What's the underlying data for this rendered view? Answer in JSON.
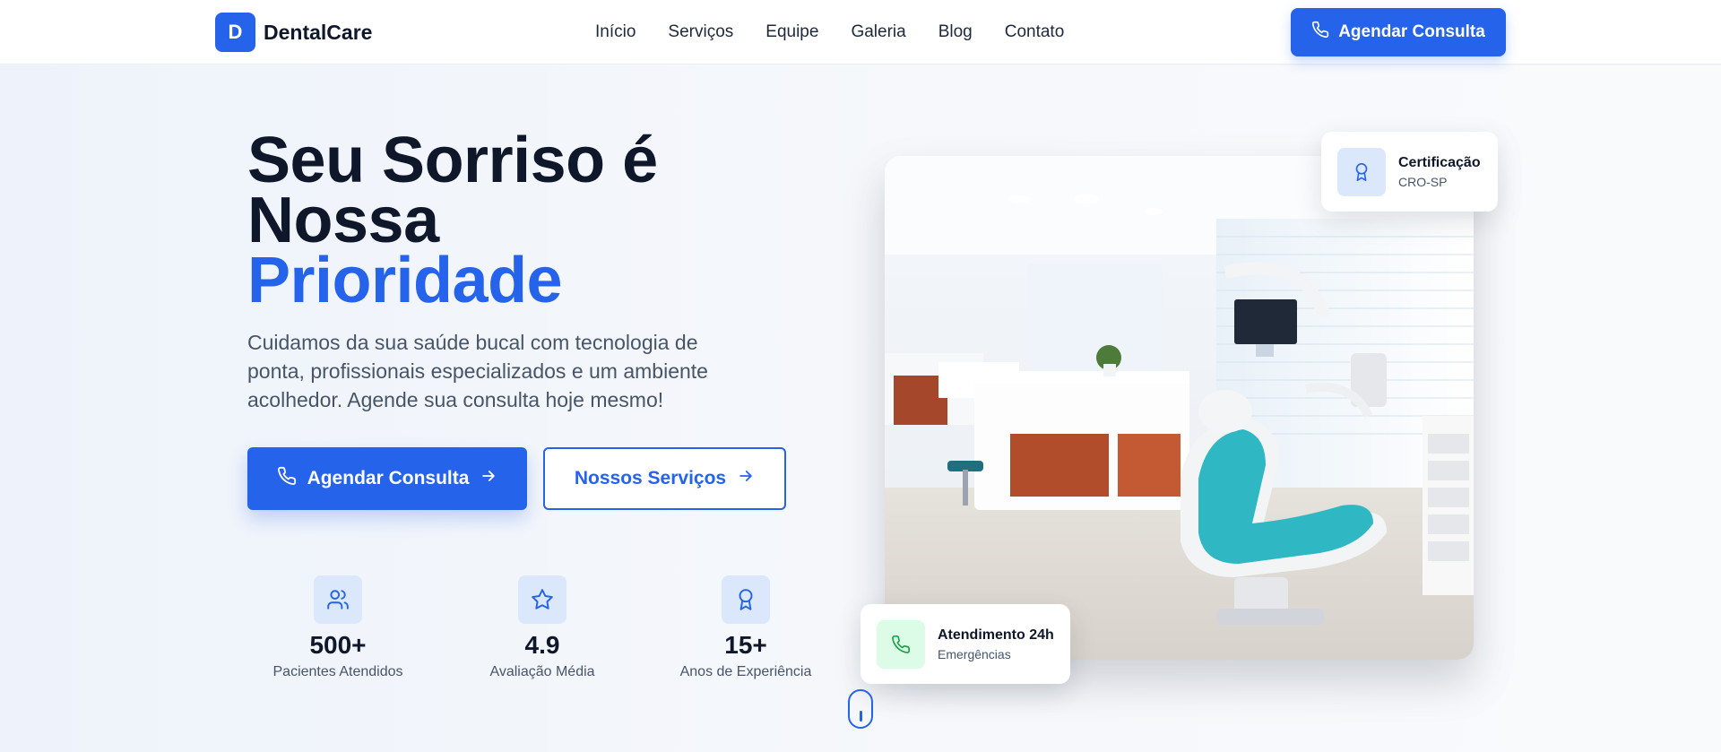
{
  "header": {
    "logo_letter": "D",
    "brand": "DentalCare",
    "nav": [
      "Início",
      "Serviços",
      "Equipe",
      "Galeria",
      "Blog",
      "Contato"
    ],
    "cta_label": "Agendar Consulta"
  },
  "hero": {
    "title_line1": "Seu Sorriso é",
    "title_line2": "Nossa",
    "title_accent": "Prioridade",
    "subtitle": "Cuidamos da sua saúde bucal com tecnologia de ponta, profissionais especializados e um ambiente acolhedor. Agende sua consulta hoje mesmo!",
    "primary_button": "Agendar Consulta",
    "secondary_button": "Nossos Serviços"
  },
  "stats": [
    {
      "icon": "users-icon",
      "value": "500+",
      "label": "Pacientes Atendidos"
    },
    {
      "icon": "star-icon",
      "value": "4.9",
      "label": "Avaliação Média"
    },
    {
      "icon": "award-icon",
      "value": "15+",
      "label": "Anos de Experiência"
    }
  ],
  "badges": {
    "certification_title": "Certificação",
    "certification_sub": "CRO-SP",
    "emergency_title": "Atendimento 24h",
    "emergency_sub": "Emergências"
  },
  "colors": {
    "accent": "#2563eb",
    "accent_light": "#dbe7fb",
    "success_light": "#dcfce7",
    "success": "#16a34a",
    "heading": "#0f172a",
    "body_text": "#475569"
  }
}
